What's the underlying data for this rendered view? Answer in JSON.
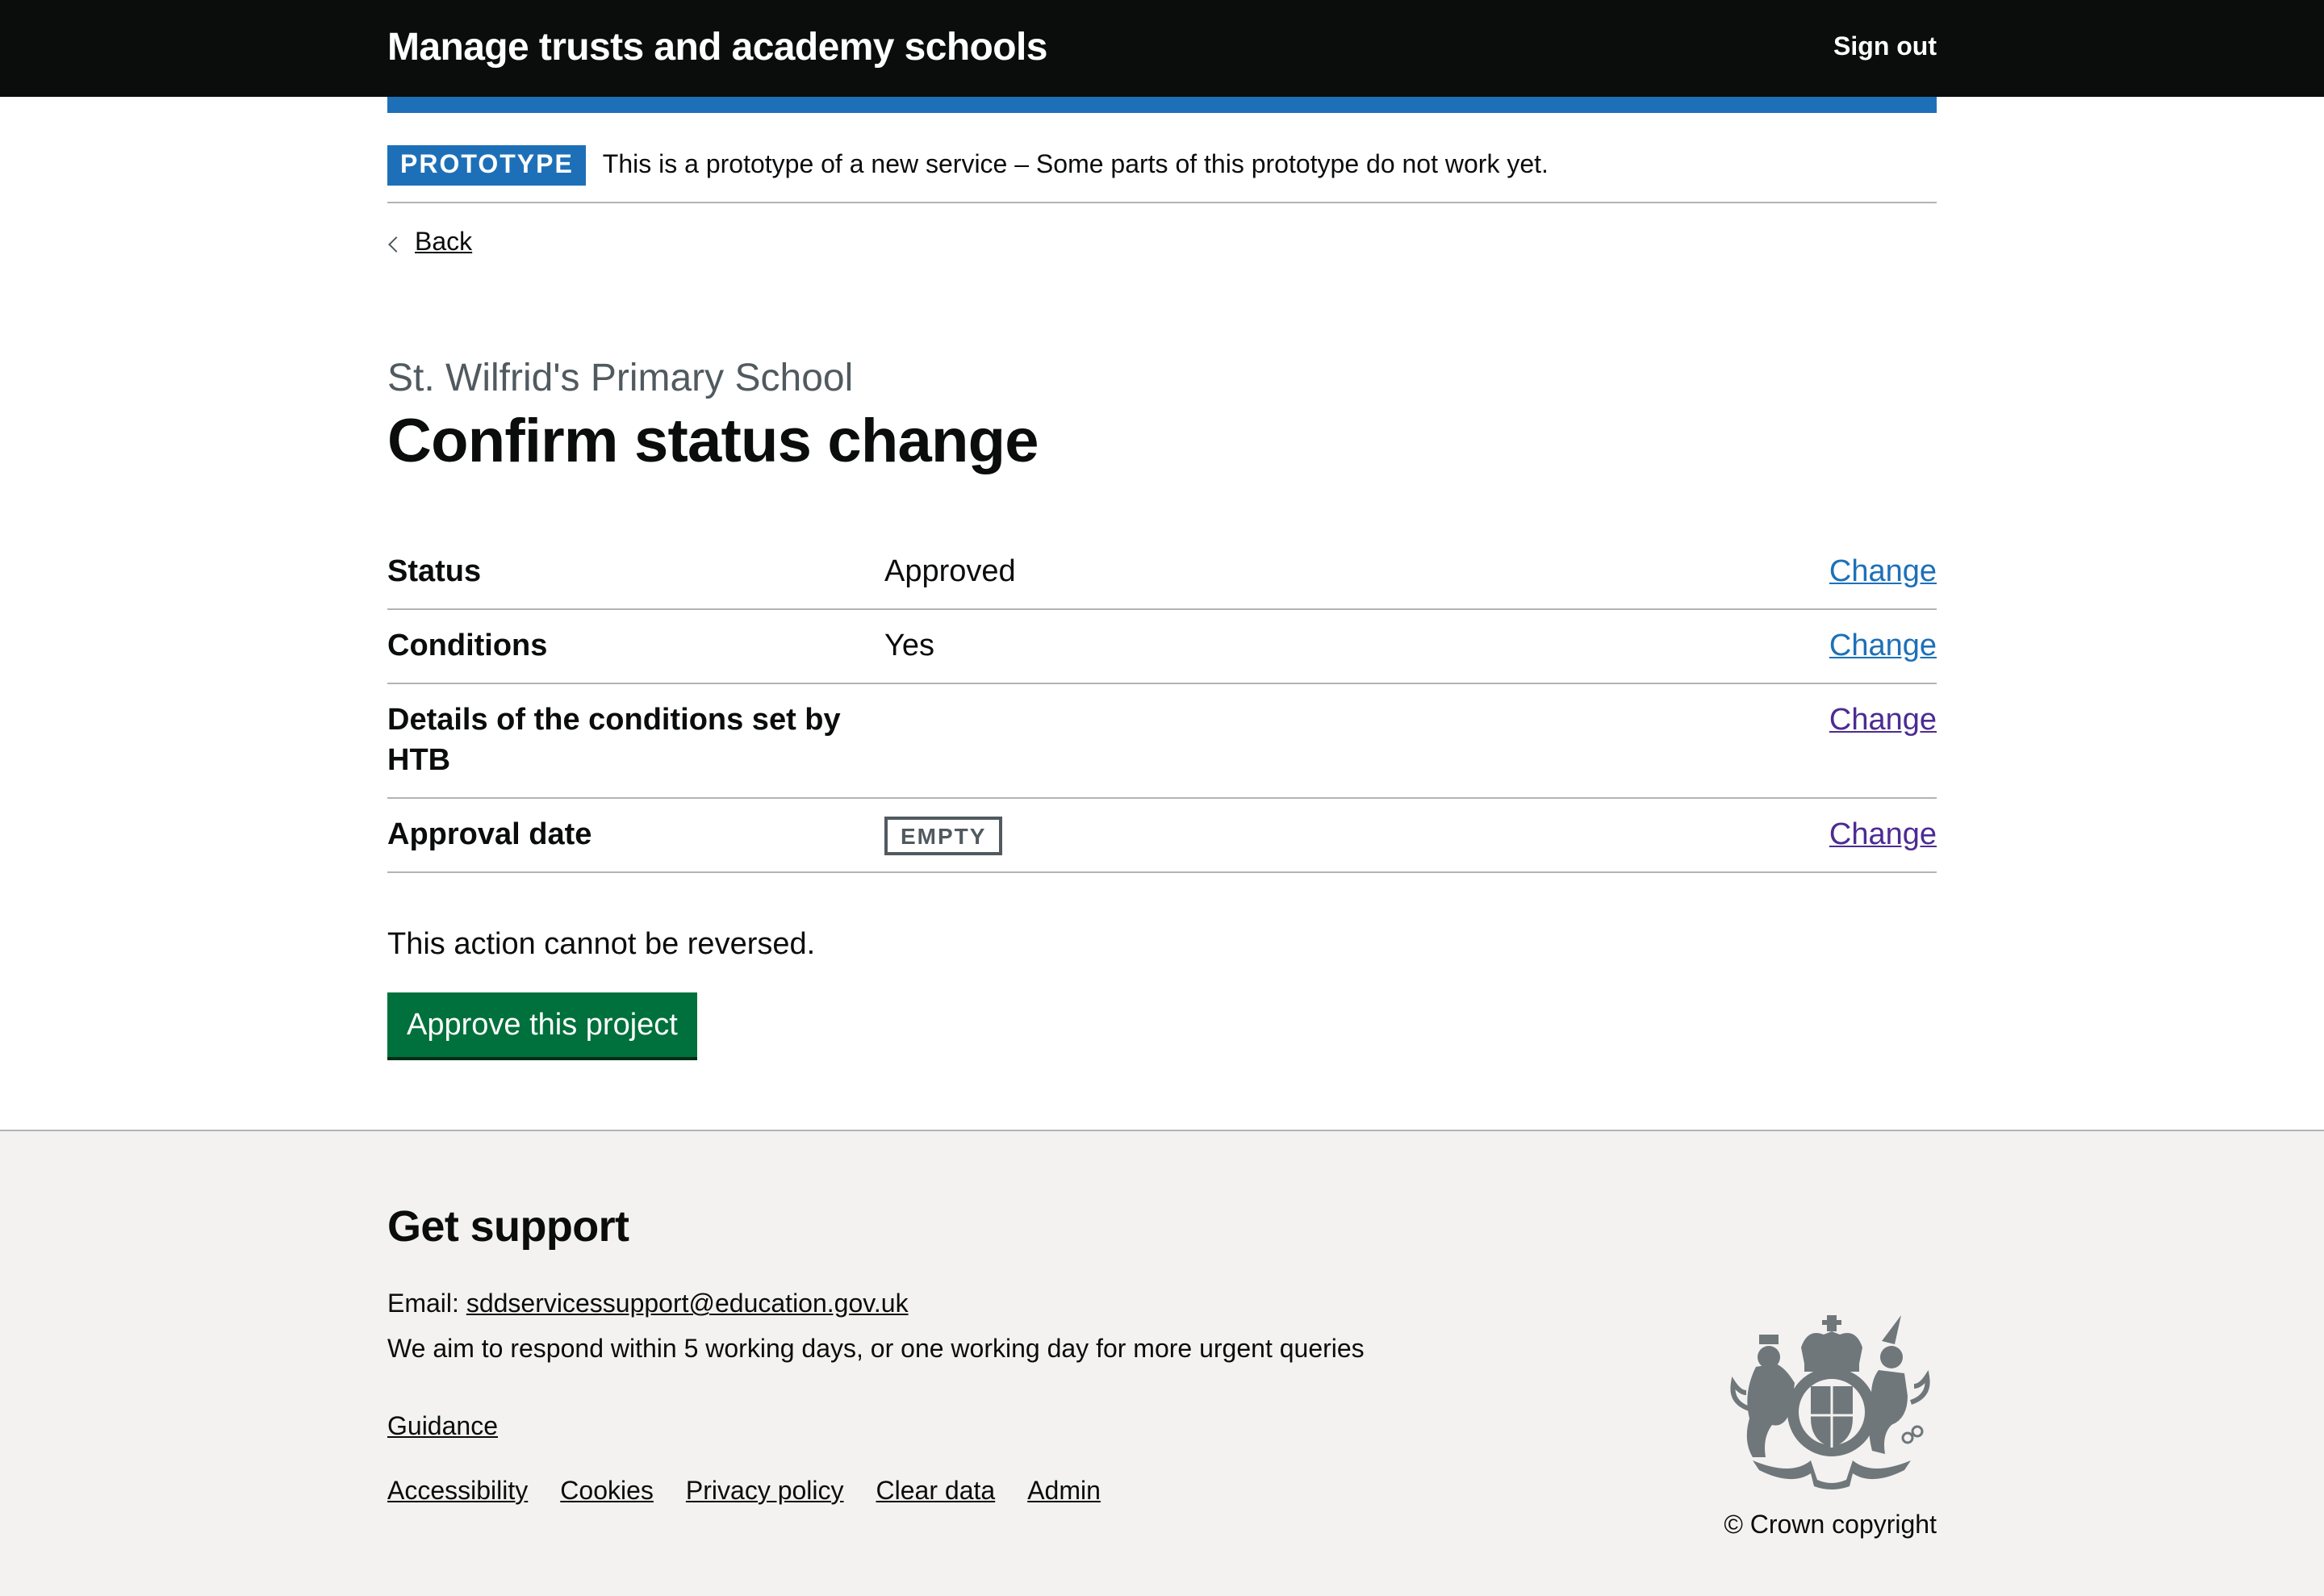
{
  "header": {
    "service_name": "Manage trusts and academy schools",
    "sign_out": "Sign out"
  },
  "phase_banner": {
    "tag": "PROTOTYPE",
    "text": "This is a prototype of a new service – Some parts of this prototype do not work yet."
  },
  "back_link": "Back",
  "caption": "St. Wilfrid's Primary School",
  "title": "Confirm status change",
  "summary": [
    {
      "key": "Status",
      "value": "Approved",
      "action": "Change",
      "visited": false
    },
    {
      "key": "Conditions",
      "value": "Yes",
      "action": "Change",
      "visited": false
    },
    {
      "key": "Details of the conditions set by HTB",
      "value": "",
      "action": "Change",
      "visited": true
    },
    {
      "key": "Approval date",
      "value_tag": "EMPTY",
      "action": "Change",
      "visited": true
    }
  ],
  "notice": "This action cannot be reversed.",
  "primary_button": "Approve this project",
  "footer": {
    "heading": "Get support",
    "email_label": "Email: ",
    "email": "sddservicessupport@education.gov.uk",
    "response_text": "We aim to respond within 5 working days, or one working day for more urgent queries",
    "guidance": "Guidance",
    "links": [
      "Accessibility",
      "Cookies",
      "Privacy policy",
      "Clear data",
      "Admin"
    ],
    "copyright": "© Crown copyright"
  },
  "colors": {
    "header_bg": "#0b0c0c",
    "brand_blue": "#1d70b8",
    "link_visited": "#4c2c92",
    "button_green": "#00703c",
    "footer_bg": "#f3f2f1",
    "secondary_text": "#505a5f"
  }
}
